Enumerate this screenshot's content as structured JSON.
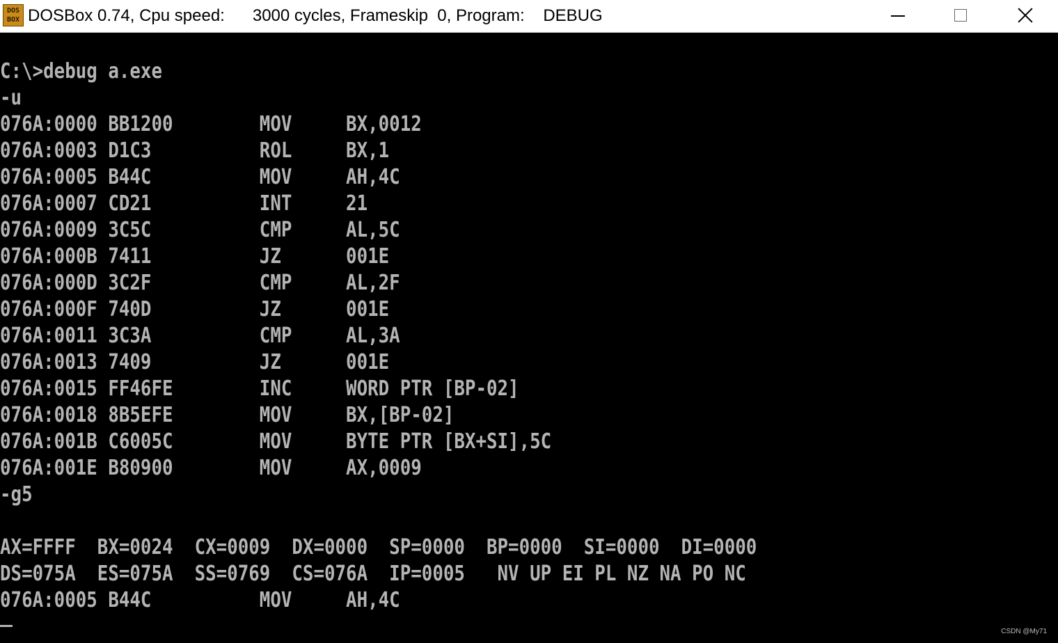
{
  "window": {
    "title": "DOSBox 0.74, Cpu speed:      3000 cycles, Frameskip  0, Program:    DEBUG",
    "icon": "dosbox-icon",
    "icon_label_top": "DOS",
    "icon_label_bottom": "BOX",
    "buttons": [
      "minimize",
      "maximize",
      "close"
    ]
  },
  "console": {
    "lines": [
      "C:\\>debug a.exe",
      "-u",
      "076A:0000 BB1200        MOV     BX,0012",
      "076A:0003 D1C3          ROL     BX,1",
      "076A:0005 B44C          MOV     AH,4C",
      "076A:0007 CD21          INT     21",
      "076A:0009 3C5C          CMP     AL,5C",
      "076A:000B 7411          JZ      001E",
      "076A:000D 3C2F          CMP     AL,2F",
      "076A:000F 740D          JZ      001E",
      "076A:0011 3C3A          CMP     AL,3A",
      "076A:0013 7409          JZ      001E",
      "076A:0015 FF46FE        INC     WORD PTR [BP-02]",
      "076A:0018 8B5EFE        MOV     BX,[BP-02]",
      "076A:001B C6005C        MOV     BYTE PTR [BX+SI],5C",
      "076A:001E B80900        MOV     AX,0009",
      "-g5",
      "",
      "AX=FFFF  BX=0024  CX=0009  DX=0000  SP=0000  BP=0000  SI=0000  DI=0000",
      "DS=075A  ES=075A  SS=0769  CS=076A  IP=0005   NV UP EI PL NZ NA PO NC",
      "076A:0005 B44C          MOV     AH,4C"
    ]
  },
  "watermark": "CSDN @My71",
  "colors": {
    "console_bg": "#000000",
    "console_fg": "#b4b4b4",
    "titlebar_bg": "#ffffff"
  }
}
